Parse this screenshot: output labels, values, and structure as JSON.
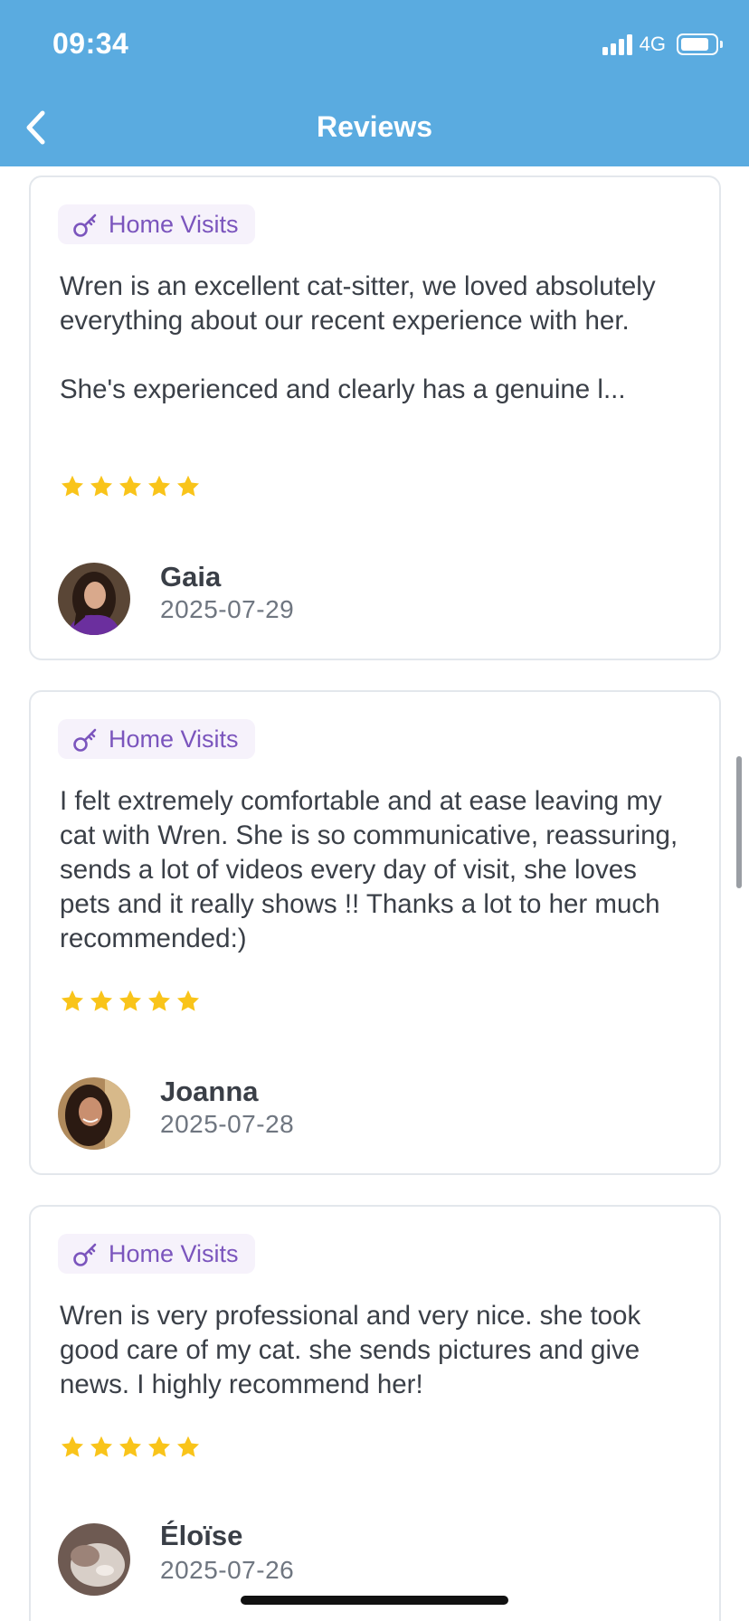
{
  "status_bar": {
    "time": "09:34",
    "network": "4G"
  },
  "header": {
    "title": "Reviews",
    "back_icon": "chevron-left-icon"
  },
  "colors": {
    "header": "#5aabe0",
    "tag_text": "#7b55bd",
    "tag_bg": "#f6f2fb",
    "star": "#f9c41a"
  },
  "reviews": [
    {
      "service": "Home Visits",
      "service_icon": "key-icon",
      "text": "Wren is an excellent cat-sitter, we loved absolutely everything about our recent experience with her.\n\nShe's experienced and clearly has a genuine l...",
      "rating": 5,
      "name": "Gaia",
      "date": "2025-07-29"
    },
    {
      "service": "Home Visits",
      "service_icon": "key-icon",
      "text": "I felt extremely comfortable and at ease leaving my cat with Wren. She is so communicative, reassuring,  sends a lot of videos every day of visit, she loves pets and it really shows !! Thanks a lot to her much recommended:)",
      "rating": 5,
      "name": "Joanna",
      "date": "2025-07-28"
    },
    {
      "service": "Home Visits",
      "service_icon": "key-icon",
      "text": "Wren is very professional and very nice. she took good care of my cat. she sends pictures and give news. I highly recommend her!",
      "rating": 5,
      "name": "Éloïse",
      "date": "2025-07-26"
    }
  ]
}
